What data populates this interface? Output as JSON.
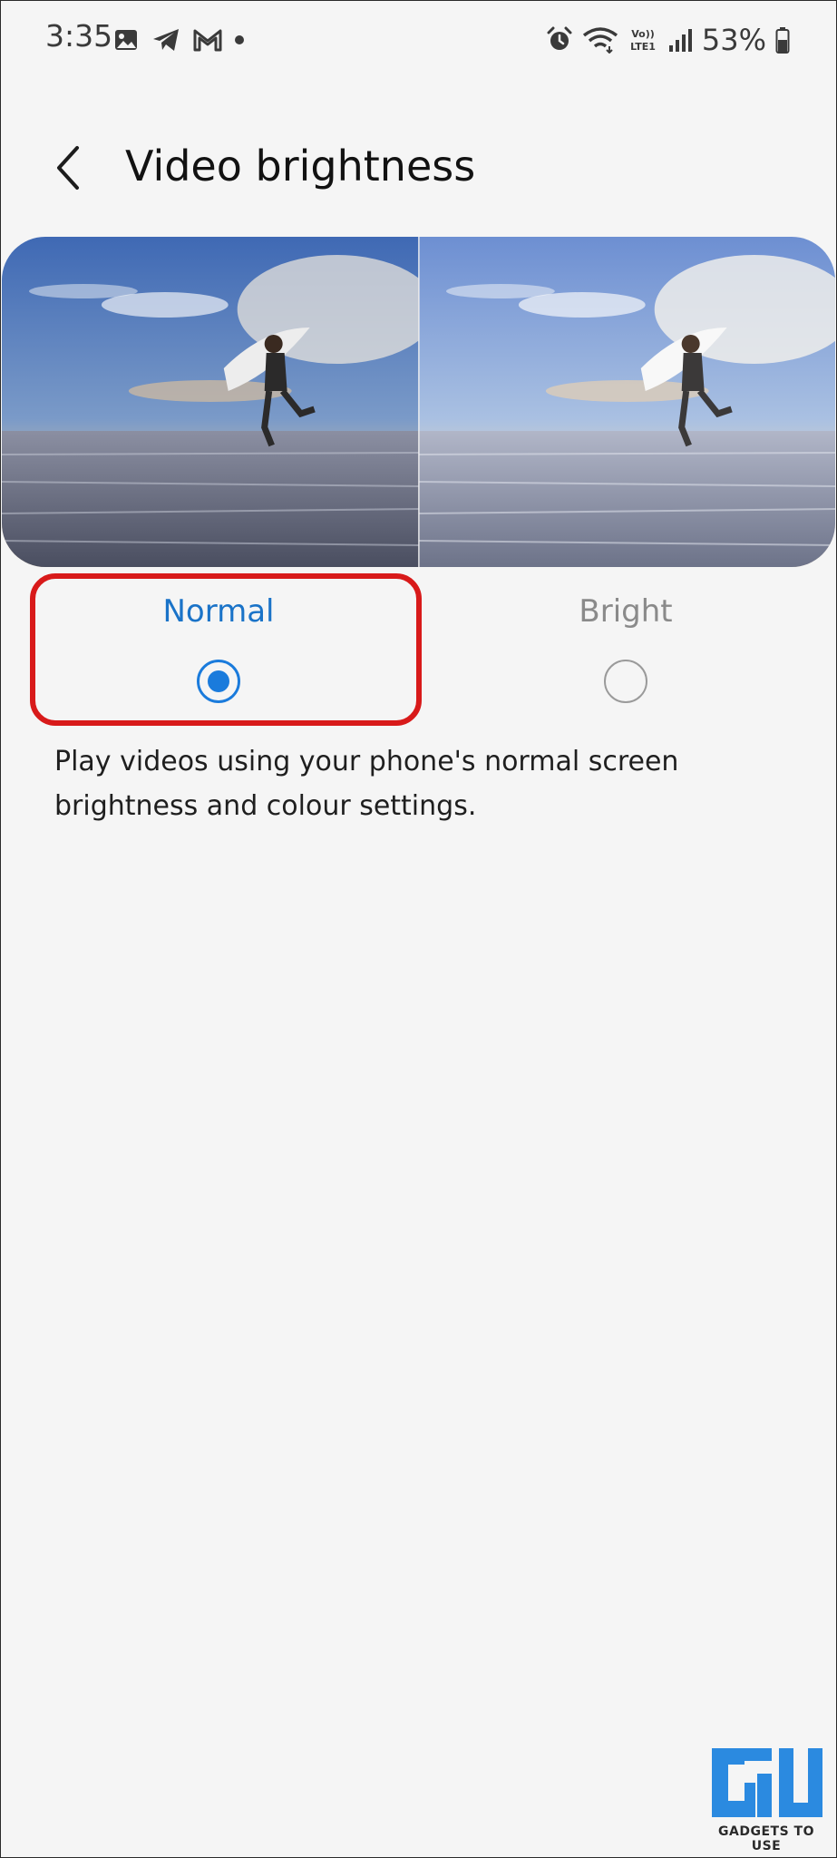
{
  "status_bar": {
    "time": "3:35",
    "battery": "53%",
    "left_icons": [
      "gallery-icon",
      "telegram-icon",
      "gmail-icon",
      "notification-dot"
    ],
    "right_icons": [
      "alarm-icon",
      "wifi-icon",
      "volte-lte-icon",
      "signal-icon",
      "battery-icon"
    ]
  },
  "header": {
    "back_icon": "chevron-left-icon",
    "title": "Video brightness"
  },
  "preview": {
    "left_image": "surfer-beach-normal",
    "right_image": "surfer-beach-bright"
  },
  "options": [
    {
      "label": "Normal",
      "selected": true
    },
    {
      "label": "Bright",
      "selected": false
    }
  ],
  "description": "Play videos using your phone's normal screen brightness and colour settings.",
  "watermark": {
    "logo": "gadgets-to-use-logo",
    "text": "GADGETS TO USE"
  },
  "colors": {
    "accent": "#1a7bdc",
    "selected_label": "#1a73c8",
    "unselected_label": "#8a8a8a",
    "highlight_box": "#d81a1a",
    "background": "#f5f5f5"
  }
}
